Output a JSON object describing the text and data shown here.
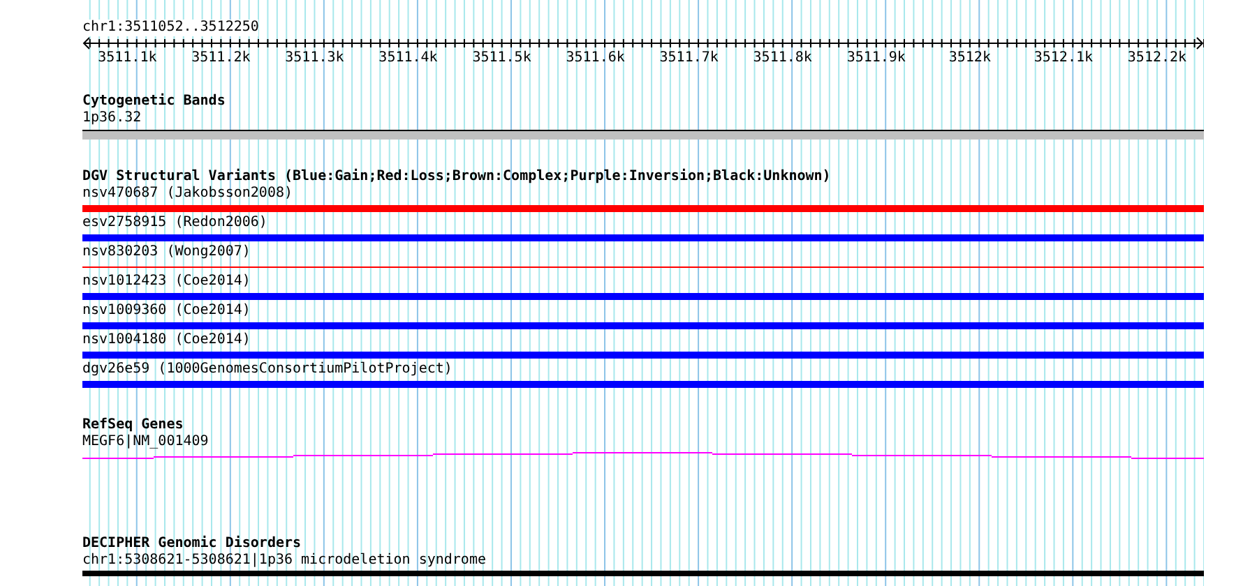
{
  "location": "chr1:3511052..3512250",
  "ruler": {
    "ticks": [
      "3511.1k",
      "3511.2k",
      "3511.3k",
      "3511.4k",
      "3511.5k",
      "3511.6k",
      "3511.7k",
      "3511.8k",
      "3511.9k",
      "3512k",
      "3512.1k",
      "3512.2k"
    ]
  },
  "tracks": [
    {
      "kind": "bands",
      "title": "Cytogenetic Bands",
      "features": [
        {
          "label": "1p36.32"
        }
      ]
    },
    {
      "kind": "variants",
      "title": "DGV Structural Variants (Blue:Gain;Red:Loss;Brown:Complex;Purple:Inversion;Black:Unknown)",
      "features": [
        {
          "label": "nsv470687 (Jakobsson2008)",
          "color": "#ff0000",
          "kind": "bar"
        },
        {
          "label": "esv2758915 (Redon2006)",
          "color": "#0000ff",
          "kind": "bar"
        },
        {
          "label": "nsv830203 (Wong2007)",
          "color": "#ff0000",
          "kind": "line"
        },
        {
          "label": "nsv1012423 (Coe2014)",
          "color": "#0000ff",
          "kind": "bar"
        },
        {
          "label": "nsv1009360 (Coe2014)",
          "color": "#0000ff",
          "kind": "bar"
        },
        {
          "label": "nsv1004180 (Coe2014)",
          "color": "#0000ff",
          "kind": "bar"
        },
        {
          "label": "dgv26e59 (1000GenomesConsortiumPilotProject)",
          "color": "#0000ff",
          "kind": "bar"
        }
      ]
    },
    {
      "kind": "genes",
      "title": "RefSeq Genes",
      "features": [
        {
          "label": "MEGF6|NM_001409"
        }
      ]
    },
    {
      "kind": "disorders",
      "title": "DECIPHER Genomic Disorders",
      "features": [
        {
          "label": "chr1:5308621-5308621|1p36 microdeletion syndrome"
        }
      ]
    }
  ]
}
